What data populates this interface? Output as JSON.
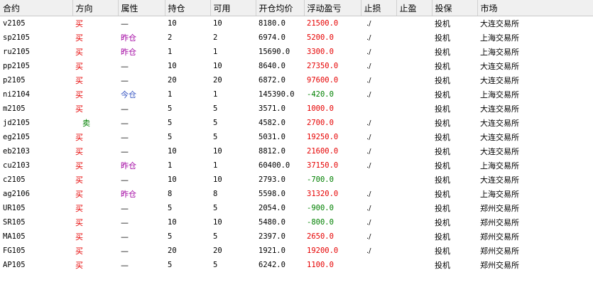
{
  "colors": {
    "buy": "#e60000",
    "sell": "#008000",
    "profit": "#e60000",
    "loss": "#008000",
    "yesterday": "#a000a0",
    "today": "#3050c0"
  },
  "columns": [
    "合约",
    "方向",
    "属性",
    "持仓",
    "可用",
    "开仓均价",
    "浮动盈亏",
    "止损",
    "止盈",
    "投保",
    "市场"
  ],
  "rows": [
    {
      "contract": "v2105",
      "dir": "买",
      "attr": "—",
      "pos": "10",
      "avail": "10",
      "price": "8180.0",
      "pnl": "21500.0",
      "stop_loss": "./",
      "take_profit": "",
      "hedge": "投机",
      "market": "大连交易所"
    },
    {
      "contract": "sp2105",
      "dir": "买",
      "attr": "昨仓",
      "pos": "2",
      "avail": "2",
      "price": "6974.0",
      "pnl": "5200.0",
      "stop_loss": "./",
      "take_profit": "",
      "hedge": "投机",
      "market": "上海交易所"
    },
    {
      "contract": "ru2105",
      "dir": "买",
      "attr": "昨仓",
      "pos": "1",
      "avail": "1",
      "price": "15690.0",
      "pnl": "3300.0",
      "stop_loss": "./",
      "take_profit": "",
      "hedge": "投机",
      "market": "上海交易所"
    },
    {
      "contract": "pp2105",
      "dir": "买",
      "attr": "—",
      "pos": "10",
      "avail": "10",
      "price": "8640.0",
      "pnl": "27350.0",
      "stop_loss": "./",
      "take_profit": "",
      "hedge": "投机",
      "market": "大连交易所"
    },
    {
      "contract": "p2105",
      "dir": "买",
      "attr": "—",
      "pos": "20",
      "avail": "20",
      "price": "6872.0",
      "pnl": "97600.0",
      "stop_loss": "./",
      "take_profit": "",
      "hedge": "投机",
      "market": "大连交易所"
    },
    {
      "contract": "ni2104",
      "dir": "买",
      "attr": "今仓",
      "pos": "1",
      "avail": "1",
      "price": "145390.0",
      "pnl": "-420.0",
      "stop_loss": "./",
      "take_profit": "",
      "hedge": "投机",
      "market": "上海交易所"
    },
    {
      "contract": "m2105",
      "dir": "买",
      "attr": "—",
      "pos": "5",
      "avail": "5",
      "price": "3571.0",
      "pnl": "1000.0",
      "stop_loss": "",
      "take_profit": "",
      "hedge": "投机",
      "market": "大连交易所"
    },
    {
      "contract": "jd2105",
      "dir": "卖",
      "attr": "—",
      "pos": "5",
      "avail": "5",
      "price": "4582.0",
      "pnl": "2700.0",
      "stop_loss": "./",
      "take_profit": "",
      "hedge": "投机",
      "market": "大连交易所"
    },
    {
      "contract": "eg2105",
      "dir": "买",
      "attr": "—",
      "pos": "5",
      "avail": "5",
      "price": "5031.0",
      "pnl": "19250.0",
      "stop_loss": "./",
      "take_profit": "",
      "hedge": "投机",
      "market": "大连交易所"
    },
    {
      "contract": "eb2103",
      "dir": "买",
      "attr": "—",
      "pos": "10",
      "avail": "10",
      "price": "8812.0",
      "pnl": "21600.0",
      "stop_loss": "./",
      "take_profit": "",
      "hedge": "投机",
      "market": "大连交易所"
    },
    {
      "contract": "cu2103",
      "dir": "买",
      "attr": "昨仓",
      "pos": "1",
      "avail": "1",
      "price": "60400.0",
      "pnl": "37150.0",
      "stop_loss": "./",
      "take_profit": "",
      "hedge": "投机",
      "market": "上海交易所"
    },
    {
      "contract": "c2105",
      "dir": "买",
      "attr": "—",
      "pos": "10",
      "avail": "10",
      "price": "2793.0",
      "pnl": "-700.0",
      "stop_loss": "",
      "take_profit": "",
      "hedge": "投机",
      "market": "大连交易所"
    },
    {
      "contract": "ag2106",
      "dir": "买",
      "attr": "昨仓",
      "pos": "8",
      "avail": "8",
      "price": "5598.0",
      "pnl": "31320.0",
      "stop_loss": "./",
      "take_profit": "",
      "hedge": "投机",
      "market": "上海交易所"
    },
    {
      "contract": "UR105",
      "dir": "买",
      "attr": "—",
      "pos": "5",
      "avail": "5",
      "price": "2054.0",
      "pnl": "-900.0",
      "stop_loss": "./",
      "take_profit": "",
      "hedge": "投机",
      "market": "郑州交易所"
    },
    {
      "contract": "SR105",
      "dir": "买",
      "attr": "—",
      "pos": "10",
      "avail": "10",
      "price": "5480.0",
      "pnl": "-800.0",
      "stop_loss": "./",
      "take_profit": "",
      "hedge": "投机",
      "market": "郑州交易所"
    },
    {
      "contract": "MA105",
      "dir": "买",
      "attr": "—",
      "pos": "5",
      "avail": "5",
      "price": "2397.0",
      "pnl": "2650.0",
      "stop_loss": "./",
      "take_profit": "",
      "hedge": "投机",
      "market": "郑州交易所"
    },
    {
      "contract": "FG105",
      "dir": "买",
      "attr": "—",
      "pos": "20",
      "avail": "20",
      "price": "1921.0",
      "pnl": "19200.0",
      "stop_loss": "./",
      "take_profit": "",
      "hedge": "投机",
      "market": "郑州交易所"
    },
    {
      "contract": "AP105",
      "dir": "买",
      "attr": "—",
      "pos": "5",
      "avail": "5",
      "price": "6242.0",
      "pnl": "1100.0",
      "stop_loss": "",
      "take_profit": "",
      "hedge": "投机",
      "market": "郑州交易所"
    }
  ]
}
